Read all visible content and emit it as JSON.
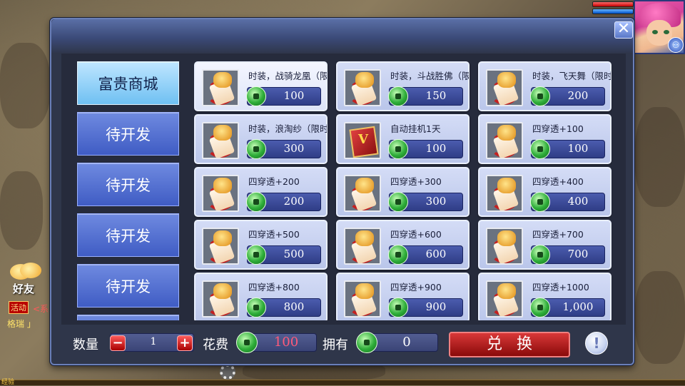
{
  "hud": {
    "portrait_icon": "player-portrait",
    "badge_icon": "buff-orb-icon"
  },
  "chat": {
    "friend_label": "好友",
    "tag": "活动",
    "line1": "<系",
    "line2": "格瑞 」"
  },
  "exp_label": "经验",
  "shop": {
    "close_label": "✕",
    "tabs": [
      {
        "label": "富贵商城",
        "active": true
      },
      {
        "label": "待开发",
        "active": false
      },
      {
        "label": "待开发",
        "active": false
      },
      {
        "label": "待开发",
        "active": false
      },
      {
        "label": "待开发",
        "active": false
      },
      {
        "label": "",
        "active": false
      }
    ],
    "items": [
      {
        "name": "时装，战骑龙凰（限",
        "price": "100",
        "icon": "fashion-scroll-icon"
      },
      {
        "name": "时装，斗战胜佛（限",
        "price": "150",
        "icon": "fashion-scroll-icon"
      },
      {
        "name": "时装，飞天舞（限时",
        "price": "200",
        "icon": "fashion-scroll-icon"
      },
      {
        "name": "时装，浪淘纱（限时",
        "price": "300",
        "icon": "fashion-scroll-icon"
      },
      {
        "name": "自动挂机1天",
        "price": "100",
        "icon": "vip-book-icon"
      },
      {
        "name": "四穿透+100",
        "price": "100",
        "icon": "scroll-icon"
      },
      {
        "name": "四穿透+200",
        "price": "200",
        "icon": "scroll-icon"
      },
      {
        "name": "四穿透+300",
        "price": "300",
        "icon": "scroll-icon"
      },
      {
        "name": "四穿透+400",
        "price": "400",
        "icon": "scroll-icon"
      },
      {
        "name": "四穿透+500",
        "price": "500",
        "icon": "scroll-icon"
      },
      {
        "name": "四穿透+600",
        "price": "600",
        "icon": "scroll-icon"
      },
      {
        "name": "四穿透+700",
        "price": "700",
        "icon": "scroll-icon"
      },
      {
        "name": "四穿透+800",
        "price": "800",
        "icon": "scroll-icon"
      },
      {
        "name": "四穿透+900",
        "price": "900",
        "icon": "scroll-icon"
      },
      {
        "name": "四穿透+1000",
        "price": "1,000",
        "icon": "scroll-icon"
      }
    ],
    "quantity_label": "数量",
    "quantity": "1",
    "minus_label": "−",
    "plus_label": "+",
    "cost_label": "花费",
    "cost_value": "100",
    "own_label": "拥有",
    "own_value": "0",
    "exchange_label": "兑换",
    "info_label": "!"
  }
}
